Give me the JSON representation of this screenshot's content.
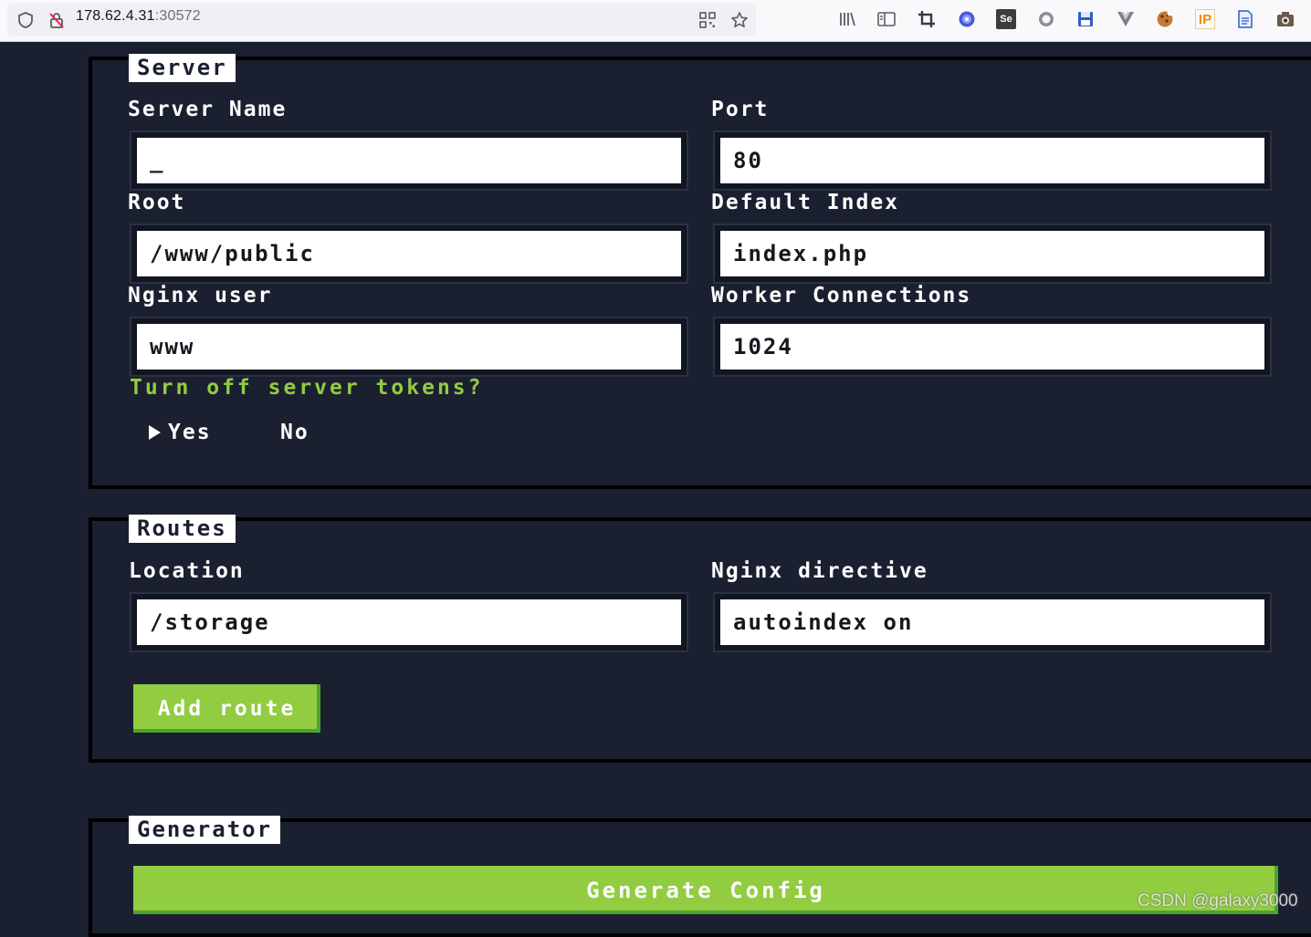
{
  "browser": {
    "url_host": "178.62.4.31",
    "url_port": ":30572",
    "extension_icons": [
      "library-icon",
      "reader-view-icon",
      "crop-icon",
      "webext-icon",
      "selenium-icon",
      "circle-icon",
      "save-icon",
      "vue-icon",
      "cookie-icon",
      "ip-icon",
      "notes-icon",
      "camera-icon"
    ],
    "se_label": "Se",
    "ip_label": "IP"
  },
  "server": {
    "legend": "Server",
    "server_name_label": "Server Name",
    "server_name_value": "_",
    "port_label": "Port",
    "port_value": "80",
    "root_label": "Root",
    "root_value": "/www/public",
    "default_index_label": "Default Index",
    "default_index_value": "index.php",
    "nginx_user_label": "Nginx user",
    "nginx_user_value": "www",
    "worker_connections_label": "Worker Connections",
    "worker_connections_value": "1024",
    "tokens_question": "Turn off server tokens?",
    "option_yes": "Yes",
    "option_no": "No",
    "selected_option": "Yes"
  },
  "routes": {
    "legend": "Routes",
    "location_label": "Location",
    "location_value": "/storage",
    "directive_label": "Nginx directive",
    "directive_value": "autoindex on",
    "add_route_label": "Add route"
  },
  "generator": {
    "legend": "Generator",
    "generate_label": "Generate Config"
  },
  "watermark": "CSDN @galaxy3000",
  "colors": {
    "background": "#1b2030",
    "accent_green": "#92cc41",
    "button_shadow": "#4aa52e"
  }
}
